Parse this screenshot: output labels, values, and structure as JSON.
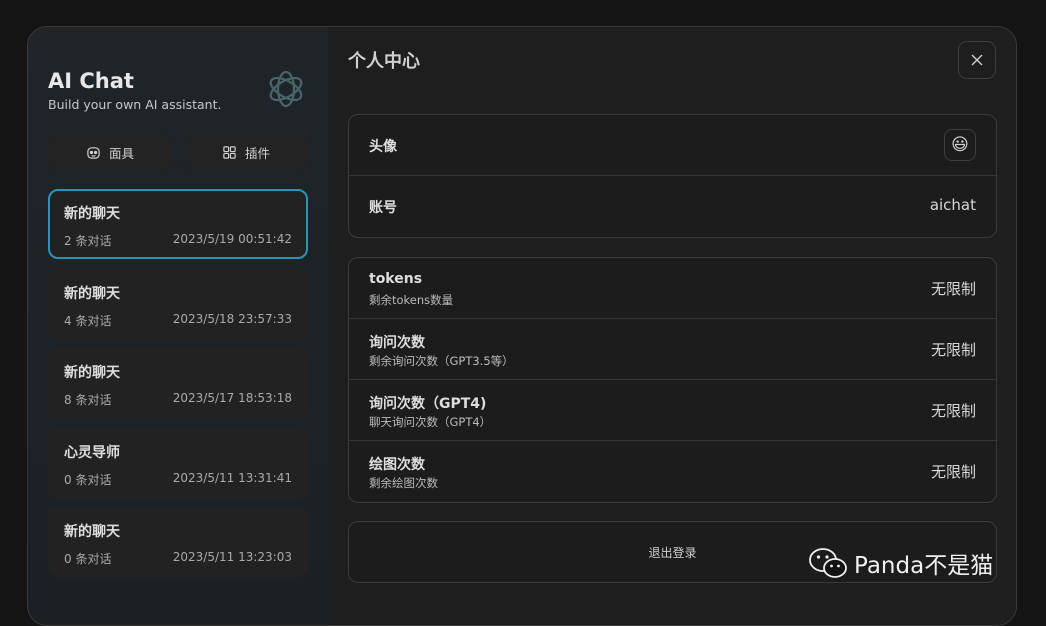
{
  "app": {
    "title": "AI Chat",
    "subtitle": "Build your own AI assistant."
  },
  "sidebar": {
    "mask_label": "面具",
    "plugin_label": "插件",
    "chats": [
      {
        "title": "新的聊天",
        "count": "2 条对话",
        "time": "2023/5/19 00:51:42",
        "active": true
      },
      {
        "title": "新的聊天",
        "count": "4 条对话",
        "time": "2023/5/18 23:57:33",
        "active": false
      },
      {
        "title": "新的聊天",
        "count": "8 条对话",
        "time": "2023/5/17 18:53:18",
        "active": false
      },
      {
        "title": "心灵导师",
        "count": "0 条对话",
        "time": "2023/5/11 13:31:41",
        "active": false
      },
      {
        "title": "新的聊天",
        "count": "0 条对话",
        "time": "2023/5/11 13:23:03",
        "active": false
      }
    ]
  },
  "profile": {
    "page_title": "个人中心",
    "avatar_label": "头像",
    "avatar_emoji": "😃",
    "account_label": "账号",
    "account_value": "aichat",
    "quota_rows": [
      {
        "title": "tokens",
        "sub": "剩余tokens数量",
        "value": "无限制"
      },
      {
        "title": "询问次数",
        "sub": "剩余询问次数（GPT3.5等）",
        "value": "无限制"
      },
      {
        "title": "询问次数（GPT4)",
        "sub": "聊天询问次数（GPT4）",
        "value": "无限制"
      },
      {
        "title": "绘图次数",
        "sub": "剩余绘图次数",
        "value": "无限制"
      }
    ],
    "logout_label": "退出登录"
  },
  "watermark": {
    "text": "Panda不是猫"
  },
  "colors": {
    "active_border": "#2a95b3",
    "background": "#141414"
  }
}
